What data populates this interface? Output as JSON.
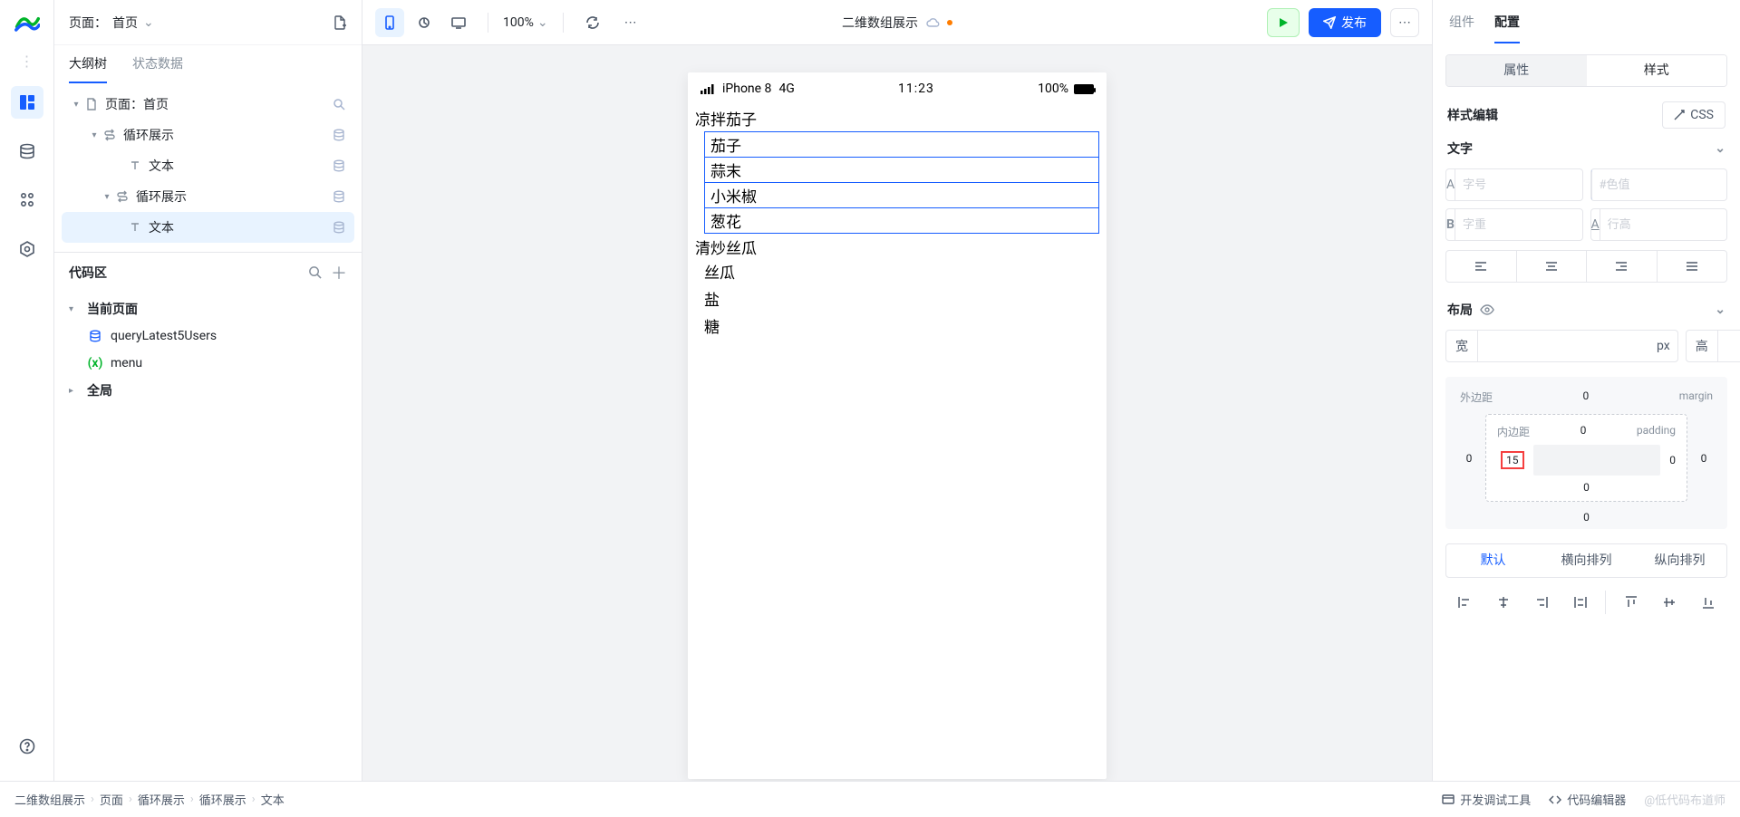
{
  "header": {
    "page_label_prefix": "页面：",
    "page_name": "首页",
    "zoom": "100%",
    "doc_title": "二维数组展示"
  },
  "publish_label": "发布",
  "left": {
    "tabs": [
      "大纲树",
      "状态数据"
    ],
    "active_tab": 0,
    "tree": [
      {
        "indent": 1,
        "twist": "▾",
        "icon": "page",
        "label": "页面：首页",
        "action": "search"
      },
      {
        "indent": 2,
        "twist": "▾",
        "icon": "loop",
        "label": "循环展示",
        "action": "db"
      },
      {
        "indent": 3,
        "twist": "",
        "icon": "text",
        "label": "文本",
        "action": "db"
      },
      {
        "indent": 3,
        "twist": "▾",
        "icon": "loop",
        "label": "循环展示",
        "action": "db",
        "indent_cls": "ind3b"
      },
      {
        "indent": 4,
        "twist": "",
        "icon": "text",
        "label": "文本",
        "action": "db",
        "selected": true
      }
    ],
    "code_title": "代码区",
    "code": [
      {
        "tw": "▾",
        "bold": true,
        "label": "当前页面"
      },
      {
        "tw": "",
        "icon": "db",
        "label": "queryLatest5Users"
      },
      {
        "tw": "",
        "icon": "var",
        "label": "menu"
      },
      {
        "tw": "▸",
        "bold": true,
        "label": "全局"
      }
    ]
  },
  "phone": {
    "device": "iPhone 8",
    "network": "4G",
    "time": "11:23",
    "battery": "100%",
    "recipes": [
      {
        "title": "凉拌茄子",
        "highlight": true,
        "items": [
          "茄子",
          "蒜末",
          "小米椒",
          "葱花"
        ]
      },
      {
        "title": "清炒丝瓜",
        "highlight": false,
        "items": [
          "丝瓜",
          "盐",
          "糖"
        ]
      }
    ]
  },
  "right": {
    "top_tabs": [
      "组件",
      "配置"
    ],
    "top_active": 1,
    "seg": [
      "属性",
      "样式"
    ],
    "seg_active": 1,
    "style_edit": "样式编辑",
    "css_btn": "CSS",
    "text_section": "文字",
    "ph_fontsize": "字号",
    "ph_color": "#色值",
    "ph_weight": "字重",
    "ph_lineheight": "行高",
    "layout_section": "布局",
    "dim_w": "宽",
    "dim_h": "高",
    "unit": "px",
    "box": {
      "margin_label": "外边距",
      "margin_top": "0",
      "margin_label_en": "margin",
      "padding_label": "内边距",
      "padding_top": "0",
      "padding_label_en": "padding",
      "pad_left": "15",
      "pad_right": "0",
      "margin_left": "0",
      "margin_right": "0",
      "pad_bottom": "0",
      "margin_bottom": "0"
    },
    "layout_modes": [
      "默认",
      "横向排列",
      "纵向排列"
    ],
    "layout_active": 0
  },
  "bottom": {
    "crumbs": [
      "二维数组展示",
      "页面",
      "循环展示",
      "循环展示",
      "文本"
    ],
    "devtool": "开发调试工具",
    "editor": "代码编辑器",
    "watermark": "@低代码布道师"
  }
}
